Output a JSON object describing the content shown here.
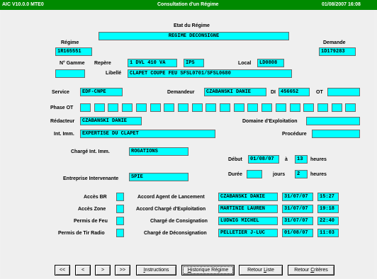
{
  "titlebar": {
    "left": "AIC V10.0.0 MTE0",
    "center": "Consultation d'un Régime",
    "right": "01/08/2007 16:08"
  },
  "etat": {
    "label": "Etat du Régime",
    "value": "REGIME DECONSIGNE"
  },
  "regime": {
    "label": "Régime",
    "value": "1R165551"
  },
  "demande": {
    "label": "Demande",
    "value": "1D179283"
  },
  "gamme": {
    "label": "N° Gamme",
    "value": ""
  },
  "repere": {
    "label": "Repère",
    "value": "1 DVL 410 VA",
    "suffix": "IPS"
  },
  "local": {
    "label": "Local",
    "value": "LD0808"
  },
  "libelle": {
    "label": "Libellé",
    "value": "CLAPET COUPE FEU SFSL0701/SFSL0680"
  },
  "service": {
    "label": "Service",
    "value": "EDF-CNPE"
  },
  "demandeur": {
    "label": "Demandeur",
    "value": "CZABANSKI DANIE"
  },
  "di": {
    "label": "DI",
    "value": "456652"
  },
  "ot": {
    "label": "OT",
    "value": ""
  },
  "phase_ot": {
    "label": "Phase OT"
  },
  "redacteur": {
    "label": "Rédacteur",
    "value": "CZABANSKI DANIE"
  },
  "domaine": {
    "label": "Domaine d'Exploitation",
    "value": ""
  },
  "int_imm": {
    "label": "Int. Imm.",
    "value": "EXPERTISE DU CLAPET"
  },
  "procedure": {
    "label": "Procédure",
    "value": ""
  },
  "charge_int": {
    "label": "Chargé Int. Imm.",
    "value": "ROGATIONS"
  },
  "debut": {
    "label": "Début",
    "date": "01/08/07",
    "a": "à",
    "heure": "13",
    "unit": "heures"
  },
  "duree": {
    "label": "Durée",
    "jours_value": "",
    "jours": "jours",
    "heure": "2",
    "unit": "heures"
  },
  "entreprise": {
    "label": "Entreprise Intervenante",
    "value": "SPIE"
  },
  "acces": {
    "br": "Accès BR",
    "zone": "Accès Zone",
    "feu": "Permis de Feu",
    "tir": "Permis de Tir Radio"
  },
  "accords": [
    {
      "label": "Accord Agent de Lancement",
      "name": "CZABANSKI DANIE",
      "date": "31/07/07",
      "time": "15:27"
    },
    {
      "label": "Accord Chargé d'Exploitation",
      "name": "MARTINIE LAUREN",
      "date": "31/07/07",
      "time": "19:18"
    },
    {
      "label": "Chargé de Consignation",
      "name": "LUDWIG MICHEL",
      "date": "31/07/07",
      "time": "22:40"
    },
    {
      "label": "Chargé de Déconsignation",
      "name": "PELLETIER J-LUC",
      "date": "01/08/07",
      "time": "11:03"
    }
  ],
  "nav": {
    "first": "<<",
    "prev": "<",
    "next": ">",
    "last": ">>"
  },
  "buttons": {
    "instructions_u": "I",
    "instructions_rest": "nstructions",
    "historique_u": "H",
    "historique_rest": "istorique Régime",
    "retour_liste_pre": "Retour ",
    "retour_liste_u": "L",
    "retour_liste_rest": "iste",
    "retour_criteres_pre": "Retour ",
    "retour_criteres_u": "C",
    "retour_criteres_rest": "ritères"
  }
}
